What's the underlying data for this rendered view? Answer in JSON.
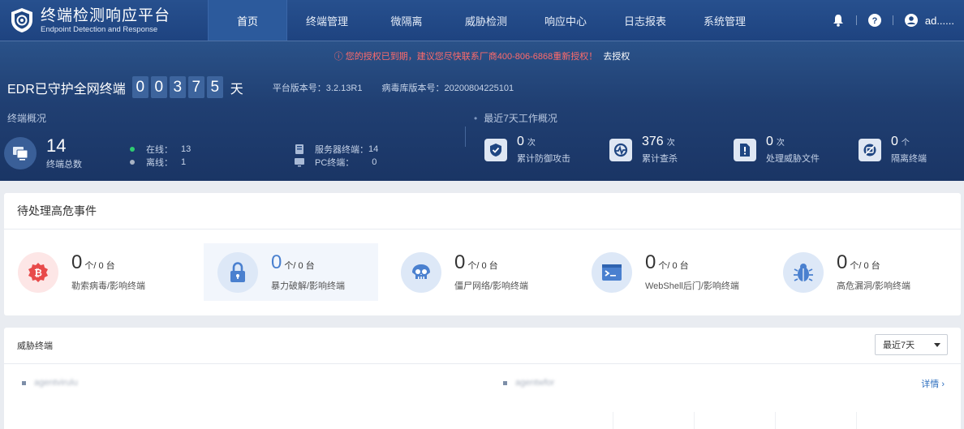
{
  "topnav": {
    "title": "终端检测响应平台",
    "subtitle": "Endpoint Detection and Response",
    "items": [
      {
        "label": "首页",
        "active": true
      },
      {
        "label": "终端管理"
      },
      {
        "label": "微隔离"
      },
      {
        "label": "威胁检测"
      },
      {
        "label": "响应中心"
      },
      {
        "label": "日志报表"
      },
      {
        "label": "系统管理"
      }
    ],
    "user": "ad......",
    "icons": [
      "bell-icon",
      "help-icon",
      "user-icon"
    ]
  },
  "alert": {
    "text": "ⓘ 您的授权已到期，建议您尽快联系厂商400-806-6868重新授权！",
    "link": "去授权"
  },
  "protect": {
    "label": "EDR已守护全网终端",
    "digits": [
      "0",
      "0",
      "3",
      "7",
      "5"
    ],
    "unit": "天",
    "platform_version": "平台版本号：3.2.13R1",
    "virus_db_version": "病毒库版本号：20200804225101"
  },
  "overview": {
    "title": "终端概况",
    "total": "14",
    "total_label": "终端总数",
    "online_label": "在线：",
    "online": "13",
    "offline_label": "离线：",
    "offline": "1",
    "server_label": "服务器终端：",
    "server": "14",
    "pc_label": "PC终端：",
    "pc": "0",
    "colors": {
      "online": "#2ecc71",
      "offline": "#a8b3c4"
    }
  },
  "week": {
    "title": "最近7天工作概况",
    "stats": [
      {
        "num": "0",
        "unit": "次",
        "label": "累计防御攻击",
        "icon": "shield-check-icon"
      },
      {
        "num": "376",
        "unit": "次",
        "label": "累计查杀",
        "icon": "scan-icon"
      },
      {
        "num": "0",
        "unit": "次",
        "label": "处理威胁文件",
        "icon": "file-alert-icon"
      },
      {
        "num": "0",
        "unit": "个",
        "label": "隔离终端",
        "icon": "isolate-icon"
      }
    ]
  },
  "events": {
    "title": "待处理高危事件",
    "items": [
      {
        "num": "0",
        "unit": "个/ 0 台",
        "label": "勒索病毒/影响终端",
        "icon": "bitcoin-icon",
        "color": "#e84a4a"
      },
      {
        "num": "0",
        "unit": "个/ 0 台",
        "label": "暴力破解/影响终端",
        "icon": "lock-icon",
        "color": "#4a80cf"
      },
      {
        "num": "0",
        "unit": "个/ 0 台",
        "label": "僵尸网络/影响终端",
        "icon": "skull-icon",
        "color": "#4a80cf"
      },
      {
        "num": "0",
        "unit": "个/ 0 台",
        "label": "WebShell后门/影响终端",
        "icon": "terminal-icon",
        "color": "#4a80cf"
      },
      {
        "num": "0",
        "unit": "个/ 0 台",
        "label": "高危漏洞/影响终端",
        "icon": "bug-icon",
        "color": "#4a80cf"
      }
    ]
  },
  "threat": {
    "title": "威胁终端",
    "select_value": "最近7天",
    "legend": [
      "agentvirulu",
      "agentwfor"
    ],
    "detail": "详情 ›"
  }
}
